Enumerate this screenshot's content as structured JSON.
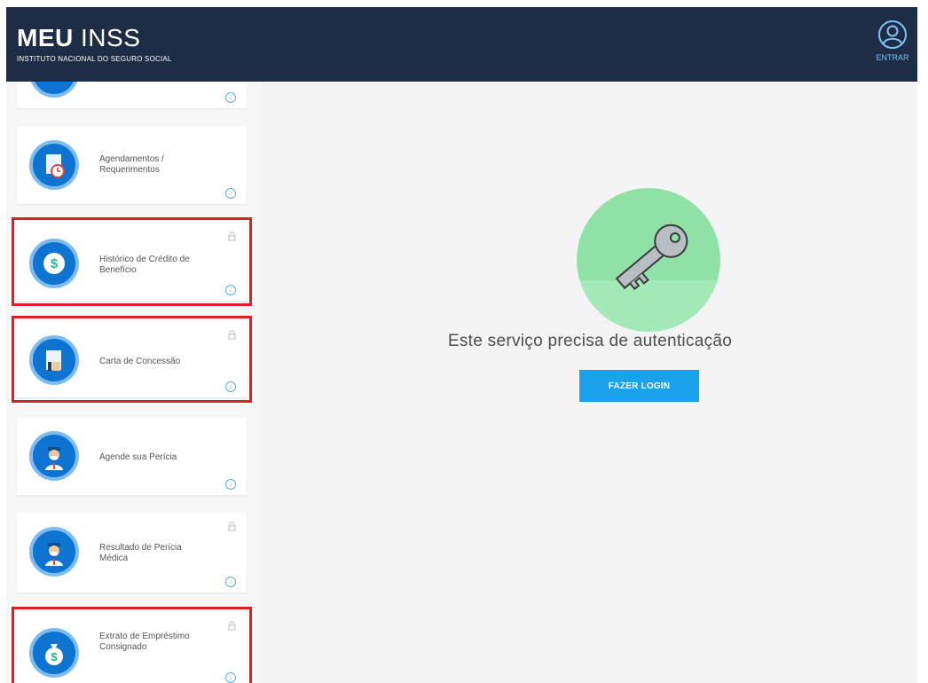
{
  "header": {
    "brand_bold": "MEU",
    "brand_rest": "INSS",
    "subtitle": "INSTITUTO NACIONAL DO SEGURO SOCIAL",
    "user_label": "ENTRAR"
  },
  "sidebar": {
    "items": [
      {
        "label": "",
        "locked": false,
        "highlighted": false,
        "icon": "service-icon"
      },
      {
        "label": "Agendamentos / Requerimentos",
        "locked": false,
        "highlighted": false,
        "icon": "calendar-document-icon"
      },
      {
        "label": "Histórico de Crédito de Benefício",
        "locked": true,
        "highlighted": true,
        "icon": "dollar-coin-icon"
      },
      {
        "label": "Carta de Concessão",
        "locked": true,
        "highlighted": true,
        "icon": "letter-thumbs-up-icon"
      },
      {
        "label": "Agende sua Perícia",
        "locked": false,
        "highlighted": false,
        "icon": "doctor-icon"
      },
      {
        "label": "Resultado de Perícia Médica",
        "locked": true,
        "highlighted": false,
        "icon": "doctor-icon"
      },
      {
        "label": "Extrato de Empréstimo Consignado",
        "locked": true,
        "highlighted": true,
        "icon": "money-bag-icon"
      }
    ]
  },
  "main": {
    "auth_message": "Este serviço precisa de autenticação",
    "login_button": "FAZER LOGIN"
  },
  "colors": {
    "header_bg": "#1e2d45",
    "icon_blue": "#0f74d1",
    "key_green": "#8fe1a8",
    "button_blue": "#1aa2ec",
    "highlight_red": "#e02020"
  }
}
